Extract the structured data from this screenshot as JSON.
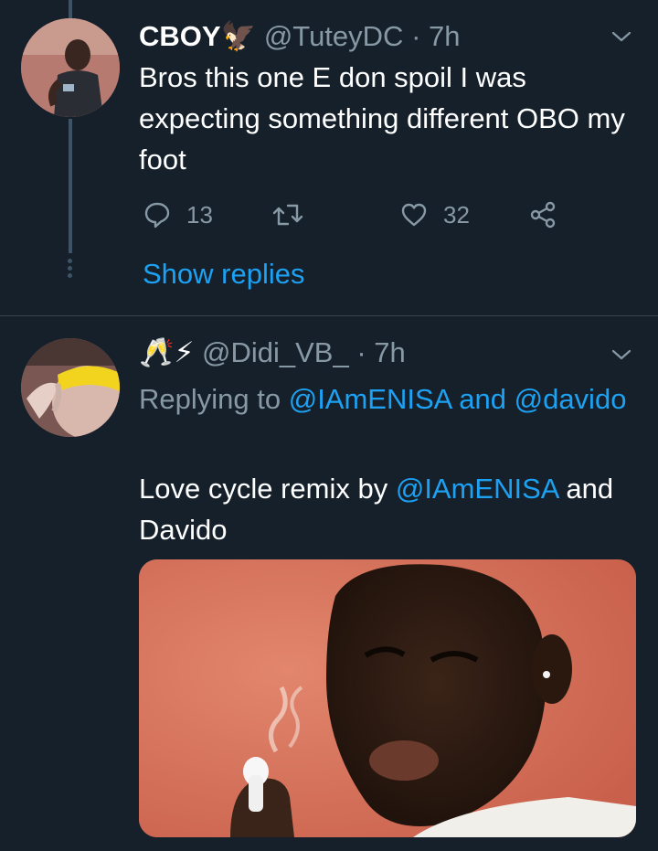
{
  "tweets": [
    {
      "display_name": "CBOY",
      "name_emoji": "🦅",
      "handle": "@TuteyDC",
      "separator": "·",
      "time": "7h",
      "text": "Bros this one E don spoil I was expecting something different OBO my foot",
      "replies": "13",
      "likes": "32",
      "show_replies": "Show replies"
    },
    {
      "name_emoji": "🥂⚡",
      "handle": "@Didi_VB_",
      "separator": "·",
      "time": "7h",
      "replying_prefix": "Replying to",
      "replying_users": [
        "@IAmENISA",
        "@davido"
      ],
      "replying_and": "and",
      "text_before": "Love cycle remix by",
      "text_mention": "@IAmENISA",
      "text_after": "and Davido"
    }
  ],
  "colors": {
    "background": "#15202b",
    "text": "#ffffff",
    "muted": "#8899a6",
    "link": "#1da1f2",
    "divider": "#38444d"
  },
  "icons": [
    "reply-icon",
    "retweet-icon",
    "like-icon",
    "share-icon",
    "chevron-down-icon"
  ]
}
